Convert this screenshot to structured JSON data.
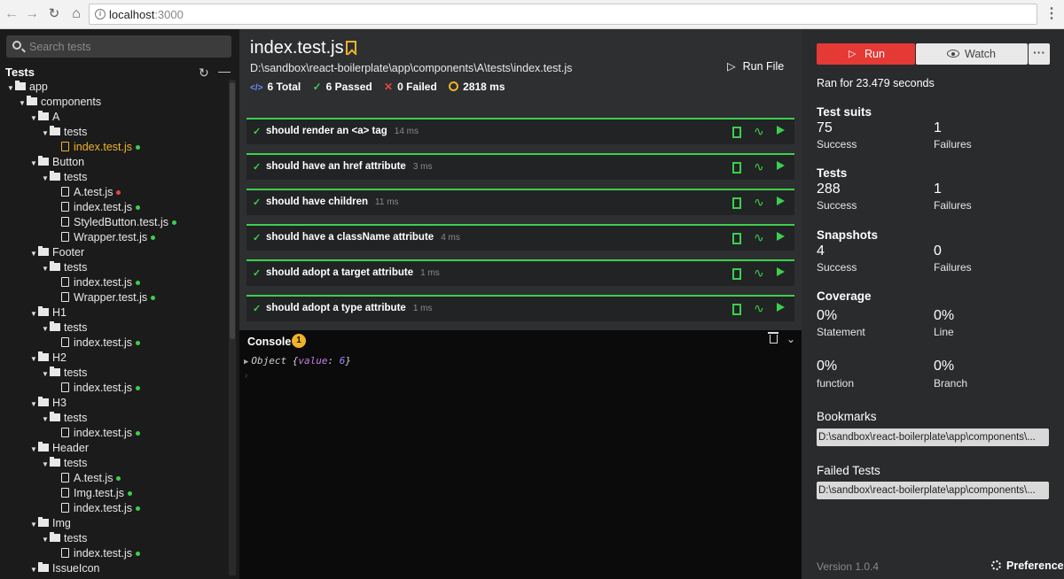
{
  "browser": {
    "url_host": "localhost",
    "url_port": ":3000"
  },
  "sidebar": {
    "search_placeholder": "Search tests",
    "tree_title": "Tests",
    "tree": [
      {
        "type": "folder",
        "depth": 0,
        "label": "app"
      },
      {
        "type": "folder",
        "depth": 1,
        "label": "components"
      },
      {
        "type": "folder",
        "depth": 2,
        "label": "A"
      },
      {
        "type": "folder",
        "depth": 3,
        "label": "tests"
      },
      {
        "type": "file",
        "depth": 4,
        "label": "index.test.js",
        "status": "pass",
        "active": true
      },
      {
        "type": "folder",
        "depth": 2,
        "label": "Button"
      },
      {
        "type": "folder",
        "depth": 3,
        "label": "tests"
      },
      {
        "type": "file",
        "depth": 4,
        "label": "A.test.js",
        "status": "fail"
      },
      {
        "type": "file",
        "depth": 4,
        "label": "index.test.js",
        "status": "pass"
      },
      {
        "type": "file",
        "depth": 4,
        "label": "StyledButton.test.js",
        "status": "pass"
      },
      {
        "type": "file",
        "depth": 4,
        "label": "Wrapper.test.js",
        "status": "pass"
      },
      {
        "type": "folder",
        "depth": 2,
        "label": "Footer"
      },
      {
        "type": "folder",
        "depth": 3,
        "label": "tests"
      },
      {
        "type": "file",
        "depth": 4,
        "label": "index.test.js",
        "status": "pass"
      },
      {
        "type": "file",
        "depth": 4,
        "label": "Wrapper.test.js",
        "status": "pass"
      },
      {
        "type": "folder",
        "depth": 2,
        "label": "H1"
      },
      {
        "type": "folder",
        "depth": 3,
        "label": "tests"
      },
      {
        "type": "file",
        "depth": 4,
        "label": "index.test.js",
        "status": "pass"
      },
      {
        "type": "folder",
        "depth": 2,
        "label": "H2"
      },
      {
        "type": "folder",
        "depth": 3,
        "label": "tests"
      },
      {
        "type": "file",
        "depth": 4,
        "label": "index.test.js",
        "status": "pass"
      },
      {
        "type": "folder",
        "depth": 2,
        "label": "H3"
      },
      {
        "type": "folder",
        "depth": 3,
        "label": "tests"
      },
      {
        "type": "file",
        "depth": 4,
        "label": "index.test.js",
        "status": "pass"
      },
      {
        "type": "folder",
        "depth": 2,
        "label": "Header"
      },
      {
        "type": "folder",
        "depth": 3,
        "label": "tests"
      },
      {
        "type": "file",
        "depth": 4,
        "label": "A.test.js",
        "status": "pass"
      },
      {
        "type": "file",
        "depth": 4,
        "label": "Img.test.js",
        "status": "pass"
      },
      {
        "type": "file",
        "depth": 4,
        "label": "index.test.js",
        "status": "pass"
      },
      {
        "type": "folder",
        "depth": 2,
        "label": "Img"
      },
      {
        "type": "folder",
        "depth": 3,
        "label": "tests"
      },
      {
        "type": "file",
        "depth": 4,
        "label": "index.test.js",
        "status": "pass"
      },
      {
        "type": "folder",
        "depth": 2,
        "label": "IssueIcon"
      }
    ]
  },
  "main": {
    "file_title": "index.test.js",
    "file_path": "D:\\sandbox\\react-boilerplate\\app\\components\\A\\tests\\index.test.js",
    "run_file_label": "Run File",
    "stats": {
      "total": "6 Total",
      "passed": "6 Passed",
      "failed": "0 Failed",
      "duration": "2818 ms"
    },
    "tests": [
      {
        "name": "should render an <a> tag",
        "time": "14 ms"
      },
      {
        "name": "should have an href attribute",
        "time": "3 ms"
      },
      {
        "name": "should have children",
        "time": "11 ms"
      },
      {
        "name": "should have a className attribute",
        "time": "4 ms"
      },
      {
        "name": "should adopt a target attribute",
        "time": "1 ms"
      },
      {
        "name": "should adopt a type attribute",
        "time": "1 ms"
      }
    ]
  },
  "console": {
    "title": "Console",
    "badge": "1",
    "line_prefix": "Object {",
    "line_key": "value",
    "line_sep": ": ",
    "line_value": "6",
    "line_suffix": "}"
  },
  "right": {
    "run_label": "Run",
    "watch_label": "Watch",
    "more_label": "···",
    "ran_for": "Ran for 23.479 seconds",
    "test_suits": {
      "title": "Test suits",
      "success": "75",
      "success_label": "Success",
      "failures": "1",
      "failures_label": "Failures"
    },
    "tests": {
      "title": "Tests",
      "success": "288",
      "success_label": "Success",
      "failures": "1",
      "failures_label": "Failures"
    },
    "snapshots": {
      "title": "Snapshots",
      "success": "4",
      "success_label": "Success",
      "failures": "0",
      "failures_label": "Failures"
    },
    "coverage": {
      "title": "Coverage",
      "statement": "0%",
      "statement_label": "Statement",
      "line": "0%",
      "line_label": "Line",
      "function": "0%",
      "function_label": "function",
      "branch": "0%",
      "branch_label": "Branch"
    },
    "bookmarks_title": "Bookmarks",
    "bookmark_path": "D:\\sandbox\\react-boilerplate\\app\\components\\...",
    "failed_title": "Failed Tests",
    "failed_path": "D:\\sandbox\\react-boilerplate\\app\\components\\...",
    "version": "Version 1.0.4",
    "preference_label": "Preference"
  },
  "colors": {
    "pass": "#3ccf4e",
    "fail": "#e04848",
    "accent": "#f0b429",
    "run": "#e53935"
  }
}
